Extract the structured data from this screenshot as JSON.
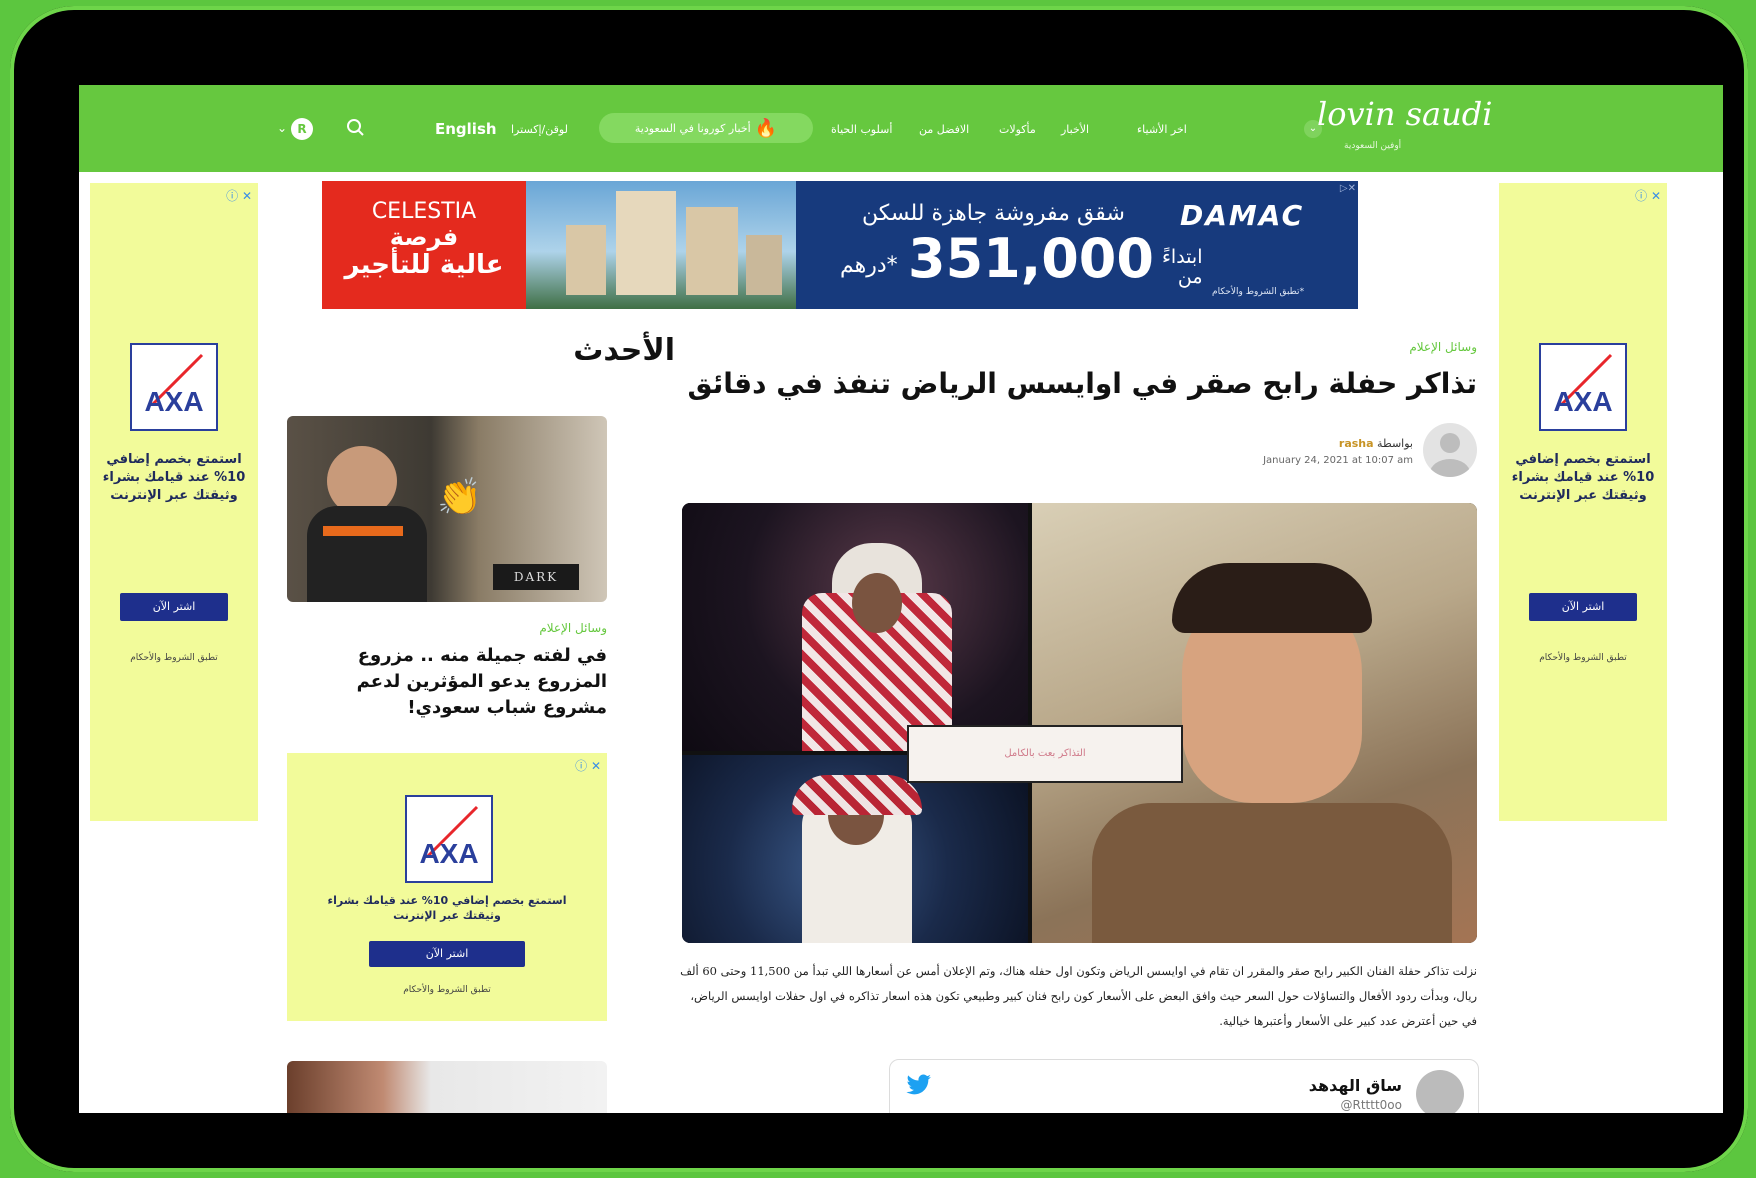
{
  "header": {
    "logo": "lovin saudi",
    "logo_sub": "أوفين السعودية",
    "nav_links": [
      "اخر الأشياء",
      "الأخبار",
      "مأكولات",
      "الافضل من",
      "أسلوب الحياة"
    ],
    "covid_pill": "أخبار كورونا في السعودية",
    "signin": "لوقن/إكسترا",
    "language": "English",
    "user_initial": "R",
    "brand_color": "#66c83f"
  },
  "banner": {
    "brand_left": "CELESTIA",
    "left_line1": "فرصة",
    "left_line2": "عالية للتأجير",
    "brand_right": "DAMAC",
    "headline": "شقق مفروشة جاهزة للسكن",
    "start_label_1": "ابتداءً",
    "start_label_2": "من",
    "price": "351,000",
    "currency": "درهم*",
    "terms": "*تطبق الشروط والأحكام"
  },
  "side_ad": {
    "brand": "AXA",
    "text": "استمتع بخصم إضافي 10% عند قيامك بشراء وثيقتك عبر الإنترنت",
    "button": "اشتر الآن",
    "terms": "تطبق الشروط والأحكام",
    "close": "ⓘ ✕"
  },
  "sidebar": {
    "title": "الأحدث",
    "item": {
      "category": "وسائل الإعلام",
      "headline": "في لفته جميلة منه .. مزروع المزروع يدعو المؤثرين لدعم مشروع شباب سعودي!"
    },
    "image_label": "DARK"
  },
  "article": {
    "category": "وسائل الإعلام",
    "title": "تذاكر حفلة رابح صقر في اوايسس الرياض تنفذ في دقائق",
    "by_label": "بواسطة",
    "author": "rasha",
    "date": "January 24, 2021 at 10:07 am",
    "image_caption": "التذاكر بعت بالكامل",
    "body": "نزلت تذاكر حفلة الفنان الكبير رابح صقر والمقرر ان تقام في اوايسس الرياض وتكون اول حفله هناك، وتم الإعلان أمس عن أسعارها اللي تبدأ من 11,500 وحتى 60 ألف ريال، وبدأت ردود الأفعال والتساؤلات حول السعر حيث وافق البعض على الأسعار كون رابح فنان كبير وطبيعي تكون هذه اسعار تذاكره في اول حفلات اوايسس الرياض، في حين أعترض عدد كبير على الأسعار وأعتبرها خيالية."
  },
  "tweet": {
    "name": "ساق الهدهد",
    "handle": "@Rtttt0oo"
  }
}
